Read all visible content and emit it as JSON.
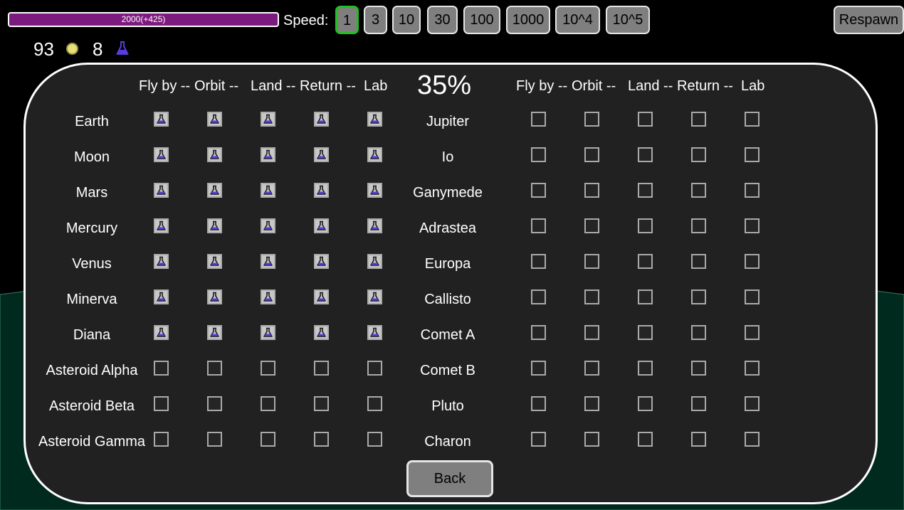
{
  "fuel": {
    "label": "2000(+425)"
  },
  "speed": {
    "label": "Speed:",
    "active": "1",
    "options": [
      "1",
      "3",
      "10",
      "30",
      "100",
      "1000",
      "10^4",
      "10^5"
    ]
  },
  "respawn_label": "Respawn",
  "resources": {
    "coins": "93",
    "science": "8"
  },
  "progress": "35%",
  "headers": {
    "fly_by": "Fly by --",
    "orbit": "Orbit --",
    "land": "Land --",
    "return": "Return --",
    "lab": "Lab"
  },
  "left_bodies": [
    {
      "name": "Earth",
      "done": [
        true,
        true,
        true,
        true,
        true
      ]
    },
    {
      "name": "Moon",
      "done": [
        true,
        true,
        true,
        true,
        true
      ]
    },
    {
      "name": "Mars",
      "done": [
        true,
        true,
        true,
        true,
        true
      ]
    },
    {
      "name": "Mercury",
      "done": [
        true,
        true,
        true,
        true,
        true
      ]
    },
    {
      "name": "Venus",
      "done": [
        true,
        true,
        true,
        true,
        true
      ]
    },
    {
      "name": "Minerva",
      "done": [
        true,
        true,
        true,
        true,
        true
      ]
    },
    {
      "name": "Diana",
      "done": [
        true,
        true,
        true,
        true,
        true
      ]
    },
    {
      "name": "Asteroid Alpha",
      "done": [
        false,
        false,
        false,
        false,
        false
      ]
    },
    {
      "name": "Asteroid Beta",
      "done": [
        false,
        false,
        false,
        false,
        false
      ]
    },
    {
      "name": "Asteroid Gamma",
      "done": [
        false,
        false,
        false,
        false,
        false
      ]
    }
  ],
  "right_bodies": [
    {
      "name": "Jupiter",
      "done": [
        false,
        false,
        false,
        false,
        false
      ]
    },
    {
      "name": "Io",
      "done": [
        false,
        false,
        false,
        false,
        false
      ]
    },
    {
      "name": "Ganymede",
      "done": [
        false,
        false,
        false,
        false,
        false
      ]
    },
    {
      "name": "Adrastea",
      "done": [
        false,
        false,
        false,
        false,
        false
      ]
    },
    {
      "name": "Europa",
      "done": [
        false,
        false,
        false,
        false,
        false
      ]
    },
    {
      "name": "Callisto",
      "done": [
        false,
        false,
        false,
        false,
        false
      ]
    },
    {
      "name": "Comet A",
      "done": [
        false,
        false,
        false,
        false,
        false
      ]
    },
    {
      "name": "Comet B",
      "done": [
        false,
        false,
        false,
        false,
        false
      ]
    },
    {
      "name": "Pluto",
      "done": [
        false,
        false,
        false,
        false,
        false
      ]
    },
    {
      "name": "Charon",
      "done": [
        false,
        false,
        false,
        false,
        false
      ]
    }
  ],
  "back_label": "Back",
  "colors": {
    "background": "#000000",
    "ground": "#002a1e",
    "panel": "#212121",
    "fuel_bar": "#7d1a7d",
    "active_speed": "#20c020",
    "science_flask": "#5a3cdc",
    "coin": "#e8e077"
  },
  "icons": {
    "coin": "coin-icon",
    "science": "flask-icon"
  }
}
